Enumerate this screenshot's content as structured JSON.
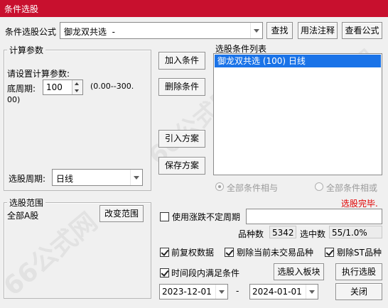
{
  "window": {
    "title": "条件选股"
  },
  "formula_row": {
    "label": "条件选股公式",
    "selected": "御龙双共选  -",
    "find_button": "查找",
    "usage_button": "用法注释",
    "view_formula_button": "查看公式"
  },
  "calc_params": {
    "title": "计算参数",
    "prompt": "请设置计算参数:",
    "param_label": "底周期:",
    "param_value": "100",
    "range_line1": "(0.00--300.",
    "range_line2": "00)",
    "period_label": "选股周期:",
    "period_value": "日线"
  },
  "middle_buttons": {
    "add": "加入条件",
    "delete": "删除条件",
    "import": "引入方案",
    "save": "保存方案"
  },
  "condition_list": {
    "title": "选股条件列表",
    "items": [
      "御龙双共选 (100) 日线"
    ]
  },
  "logic": {
    "and_label": "全部条件相与",
    "or_label": "全部条件相或",
    "and_selected": true
  },
  "status": {
    "text": "选股完毕.",
    "color": "#e00000"
  },
  "scope": {
    "title": "选股范围",
    "value": "全部A股",
    "change_button": "改变范围"
  },
  "irregular_period": {
    "label": "使用涨跌不定周期",
    "checked": false,
    "value": ""
  },
  "stats": {
    "count_label": "品种数",
    "count_value": "5342",
    "selected_label": "选中数",
    "selected_value": "55/1.0%"
  },
  "options": {
    "forward_adjust": {
      "label": "前复权数据",
      "checked": true
    },
    "exclude_untraded": {
      "label": "剔除当前未交易品种",
      "checked": true
    },
    "exclude_st": {
      "label": "剔除ST品种",
      "checked": true
    },
    "time_range": {
      "label": "时间段内满足条件",
      "checked": true
    }
  },
  "actions": {
    "to_block": "选股入板块",
    "execute": "执行选股",
    "close": "关闭"
  },
  "dates": {
    "start": "2023-12-01",
    "separator": "-",
    "end": "2024-01-01"
  },
  "watermarks": [
    "66公式网",
    "66公式网",
    "66公式网"
  ]
}
